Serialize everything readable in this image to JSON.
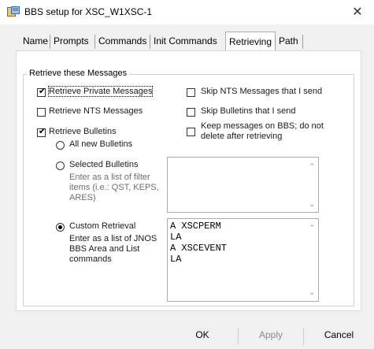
{
  "window": {
    "title": "BBS setup for XSC_W1XSC-1",
    "close_label": "✕"
  },
  "tabs": [
    {
      "label": "Name"
    },
    {
      "label": "Prompts"
    },
    {
      "label": "Commands"
    },
    {
      "label": "Init Commands"
    },
    {
      "label": "Retrieving",
      "active": true
    },
    {
      "label": "Path"
    }
  ],
  "retrieve_group": {
    "label": "Retrieve these Messages",
    "private": {
      "label": "Retrieve Private Messages",
      "checked": true
    },
    "nts": {
      "label": "Retrieve NTS Messages",
      "checked": false
    },
    "bulletins": {
      "label": "Retrieve Bulletins",
      "checked": true
    },
    "all_new": {
      "label": "All new Bulletins",
      "selected": false
    },
    "selected": {
      "label": "Selected Bulletins",
      "hint": [
        "Enter as a list of filter",
        "items (i.e.: QST, KEPS,",
        "ARES)"
      ],
      "value": "",
      "selected": false
    },
    "custom": {
      "label": "Custom Retrieval",
      "desc": [
        "Enter as a list of JNOS",
        "BBS Area and List",
        "commands"
      ],
      "value": "A XSCPERM\nLA\nA XSCEVENT\nLA",
      "selected": true
    },
    "skip_nts": {
      "label": "Skip NTS Messages that I send",
      "checked": false
    },
    "skip_bulletins": {
      "label": "Skip Bulletins that I send",
      "checked": false
    },
    "keep_on_bbs": {
      "label_lines": [
        "Keep messages on BBS; do not",
        "delete after retrieving"
      ],
      "checked": false
    }
  },
  "buttons": {
    "ok": "OK",
    "apply": "Apply",
    "cancel": "Cancel"
  },
  "icons": {
    "app": "app-window-icon",
    "close": "close-icon"
  }
}
